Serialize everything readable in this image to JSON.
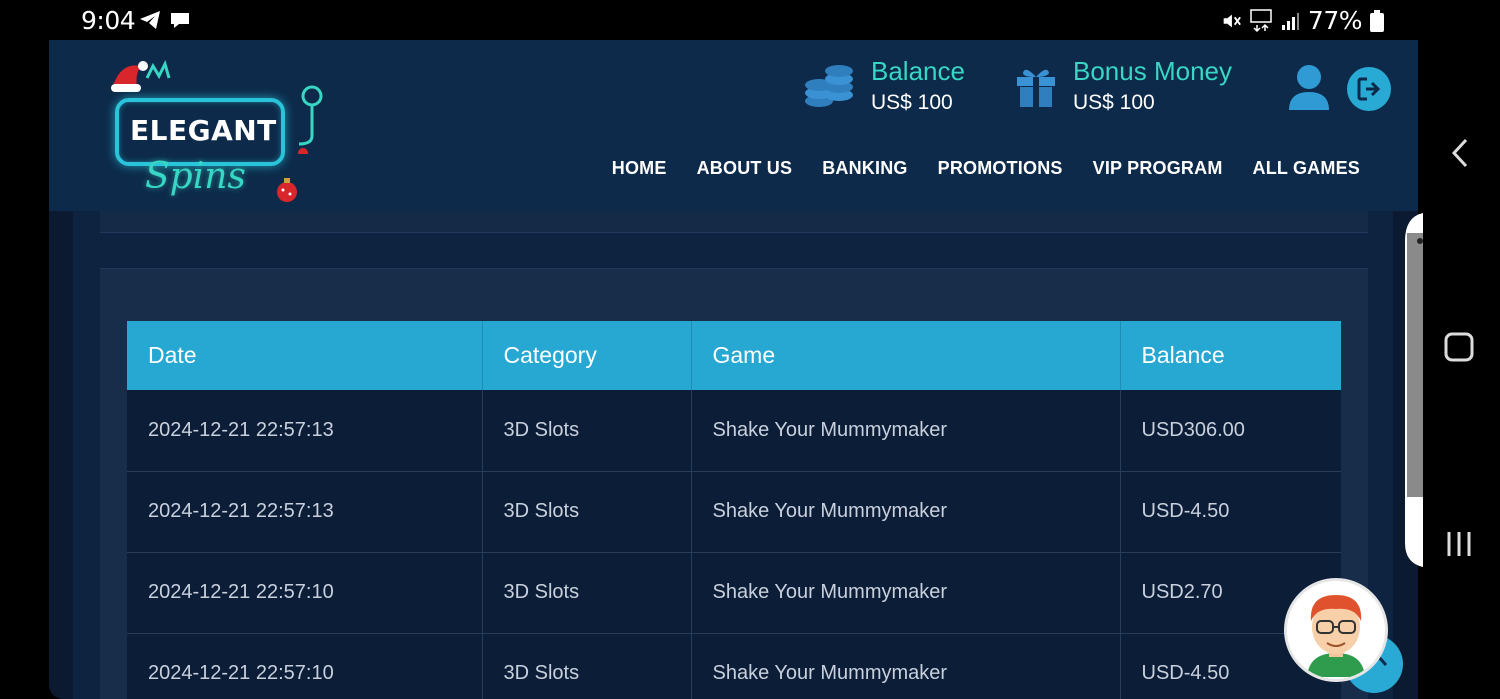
{
  "status_bar": {
    "time": "9:04",
    "battery": "77%"
  },
  "header": {
    "logo_text": "ELEGANT",
    "logo_script": "Spins",
    "balance": {
      "label": "Balance",
      "value": "US$ 100"
    },
    "bonus": {
      "label": "Bonus Money",
      "value": "US$ 100"
    },
    "nav": [
      {
        "label": "HOME"
      },
      {
        "label": "ABOUT US"
      },
      {
        "label": "BANKING"
      },
      {
        "label": "PROMOTIONS"
      },
      {
        "label": "VIP PROGRAM"
      },
      {
        "label": "ALL GAMES"
      }
    ]
  },
  "table": {
    "columns": [
      "Date",
      "Category",
      "Game",
      "Balance"
    ],
    "rows": [
      {
        "date": "2024-12-21 22:57:13",
        "category": "3D Slots",
        "game": "Shake Your Mummymaker",
        "balance": "USD306.00"
      },
      {
        "date": "2024-12-21 22:57:13",
        "category": "3D Slots",
        "game": "Shake Your Mummymaker",
        "balance": "USD-4.50"
      },
      {
        "date": "2024-12-21 22:57:10",
        "category": "3D Slots",
        "game": "Shake Your Mummymaker",
        "balance": "USD2.70"
      },
      {
        "date": "2024-12-21 22:57:10",
        "category": "3D Slots",
        "game": "Shake Your Mummymaker",
        "balance": "USD-4.50"
      }
    ]
  },
  "colors": {
    "header_bg": "#0d2a4a",
    "accent_teal": "#38d6c4",
    "accent_blue": "#27a8d3",
    "row_bg": "#0c1d38"
  }
}
